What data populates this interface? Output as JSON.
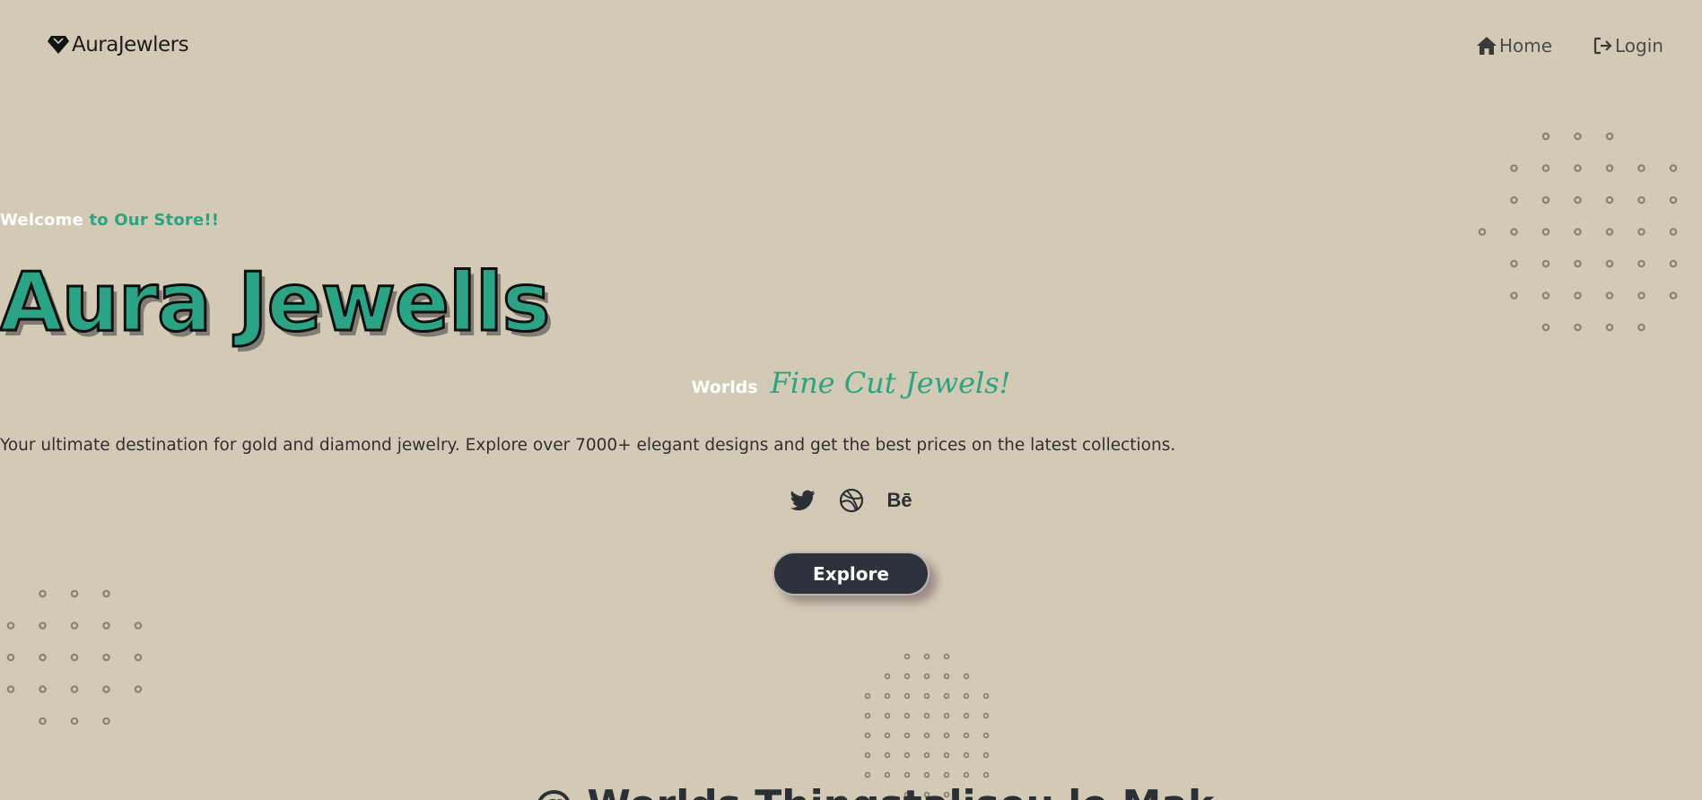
{
  "nav": {
    "brand": "AuraJewlers",
    "brand_icon": "diamond-icon",
    "home_label": "Home",
    "home_icon": "home-icon",
    "login_label": "Login",
    "login_icon": "login-icon"
  },
  "hero": {
    "welcome_a": "Welcome",
    "welcome_b": "to Our Store!!",
    "headline": "Aura Jewells",
    "tagline_a": "Worlds",
    "tagline_b": "Fine Cut Jewels!",
    "description": "Your ultimate destination for gold and diamond jewelry. Explore over 7000+ elegant designs and get the best prices on the latest collections.",
    "socials": [
      {
        "icon": "twitter-icon"
      },
      {
        "icon": "dribbble-icon"
      },
      {
        "icon": "behance-icon",
        "text": "Bē"
      }
    ],
    "cta": "Explore"
  },
  "section_heading_partial": "@ Worlds Thingstaliseu le Mak",
  "colors": {
    "background": "#d3cab5",
    "accent": "#2ba485",
    "dark": "#2d323c",
    "white": "#ffffff"
  }
}
